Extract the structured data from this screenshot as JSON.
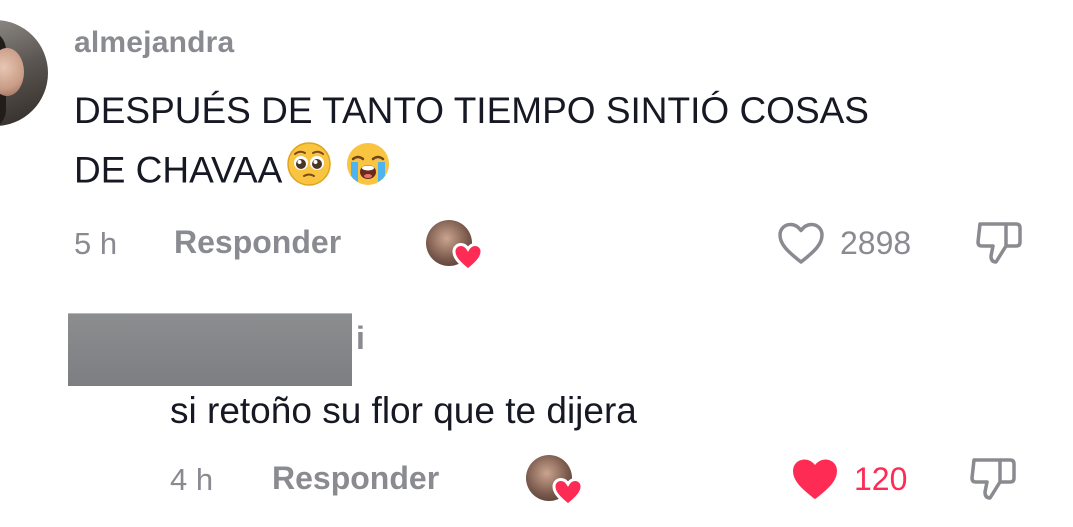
{
  "comment": {
    "username": "almejandra",
    "text_line1": "DESPUÉS DE TANTO TIEMPO SINTIÓ COSAS",
    "text_line2": "DE CHAVAA",
    "emojis": [
      "pleading-face",
      "loudly-crying-face"
    ],
    "time": "5 h",
    "reply_label": "Responder",
    "likes": "2898",
    "liked": false,
    "creator_liked": true
  },
  "reply": {
    "username_visible_tail": "i",
    "username_redacted": true,
    "text": "si retoño su flor que te dijera",
    "time": "4 h",
    "reply_label": "Responder",
    "likes": "120",
    "liked": true,
    "creator_liked": true
  },
  "colors": {
    "secondary_text": "#8a8b91",
    "primary_text": "#161823",
    "like_red": "#fe2c55"
  }
}
